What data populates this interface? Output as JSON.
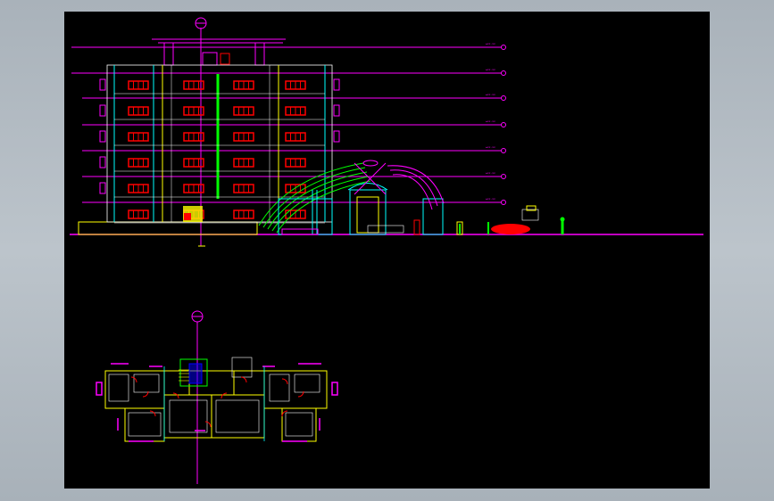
{
  "viewport": {
    "background": "#000000",
    "frame": "#b3bbc2"
  },
  "palette": {
    "magenta": "#ff00ff",
    "red": "#ff0000",
    "yellow": "#ffff00",
    "green": "#00ff00",
    "cyan": "#00ffff",
    "white": "#ffffff",
    "blue": "#0000ff"
  },
  "elevation": {
    "level_labels": [
      "±xx.xx",
      "±xx.xx",
      "±xx.xx",
      "±xx.xx",
      "±xx.xx",
      "±xx.xx",
      "±xx.xx"
    ],
    "floors": 7,
    "windows_per_floor": 4
  },
  "plan": {
    "rooms": 14
  },
  "icons": {
    "section_marker": "circle-axis-marker-icon",
    "level_marker": "level-tag-icon"
  }
}
